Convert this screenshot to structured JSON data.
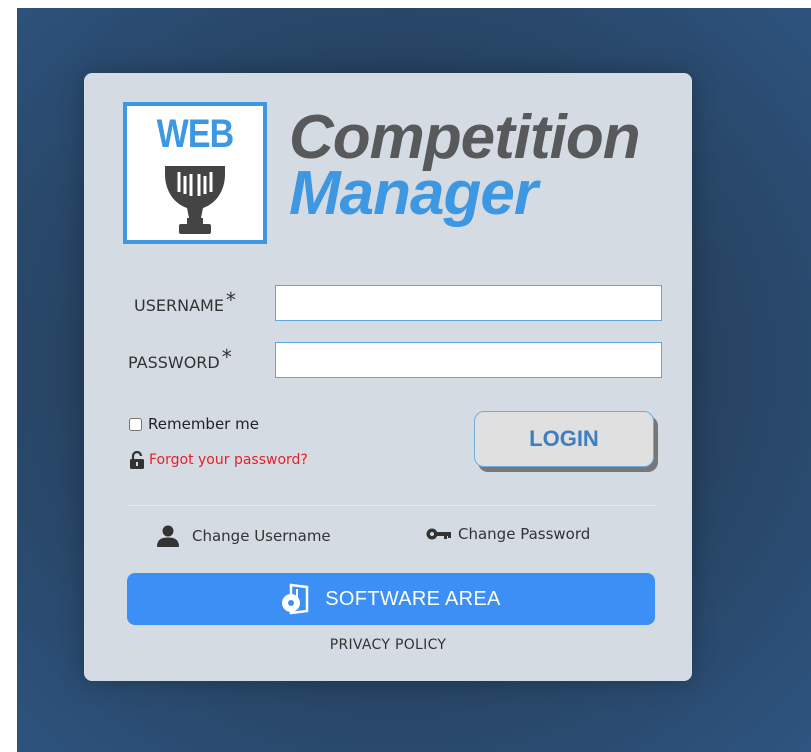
{
  "logo": {
    "badge_text": "WEB",
    "title_line1": "Competition",
    "title_line2": "Manager"
  },
  "form": {
    "username_label": "USERNAME",
    "password_label": "PASSWORD",
    "required_mark": "*",
    "username_value": "",
    "password_value": "",
    "remember_label": "Remember me",
    "remember_checked": false,
    "forgot_label": "Forgot your password?",
    "login_label": "LOGIN"
  },
  "links": {
    "change_username": "Change Username",
    "change_password": "Change Password"
  },
  "software_area_label": "SOFTWARE AREA",
  "privacy_label": "PRIVACY POLICY",
  "colors": {
    "accent": "#3d97e1",
    "button_blue": "#3b8ff5",
    "forgot_red": "#e4212b",
    "panel_bg": "#d5dbe3",
    "page_bg": "#2c4b6a"
  },
  "icons": [
    "trophy-icon",
    "lock-open-icon",
    "user-icon",
    "key-icon",
    "disc-box-icon"
  ]
}
